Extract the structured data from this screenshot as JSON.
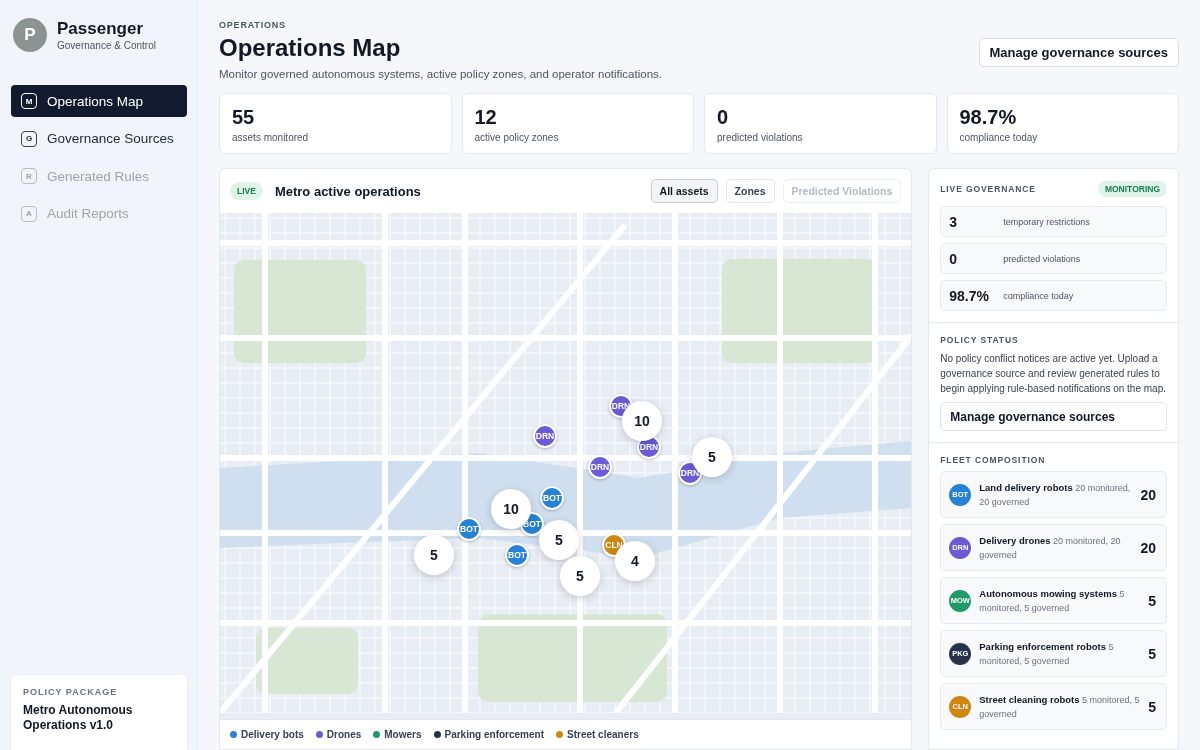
{
  "brand": {
    "initial": "P",
    "name": "Passenger",
    "tagline": "Governance & Control"
  },
  "nav": [
    {
      "key": "M",
      "label": "Operations Map",
      "selected": true,
      "disabled": false
    },
    {
      "key": "G",
      "label": "Governance Sources",
      "selected": false,
      "disabled": false
    },
    {
      "key": "R",
      "label": "Generated Rules",
      "selected": false,
      "disabled": true
    },
    {
      "key": "A",
      "label": "Audit Reports",
      "selected": false,
      "disabled": true
    }
  ],
  "policy_package": {
    "label": "POLICY PACKAGE",
    "name": "Metro Autonomous Operations v1.0"
  },
  "header": {
    "eyebrow": "OPERATIONS",
    "title": "Operations Map",
    "subtitle": "Monitor governed autonomous systems, active policy zones, and operator notifications.",
    "action": "Manage governance sources"
  },
  "stats": [
    {
      "value": "55",
      "label": "assets monitored"
    },
    {
      "value": "12",
      "label": "active policy zones"
    },
    {
      "value": "0",
      "label": "predicted violations"
    },
    {
      "value": "98.7%",
      "label": "compliance today"
    }
  ],
  "map": {
    "badge": "LIVE",
    "title": "Metro active operations",
    "filters": [
      {
        "label": "All assets",
        "selected": true,
        "disabled": false
      },
      {
        "label": "Zones",
        "selected": false,
        "disabled": false
      },
      {
        "label": "Predicted Violations",
        "selected": false,
        "disabled": true
      }
    ],
    "markers": [
      {
        "label": "DRN",
        "color": "#6b5bd6"
      },
      {
        "label": "DRN",
        "color": "#6b5bd6"
      },
      {
        "label": "DRN",
        "color": "#6b5bd6"
      },
      {
        "label": "DRN",
        "color": "#6b5bd6"
      },
      {
        "label": "DRN",
        "color": "#6b5bd6"
      },
      {
        "label": "BOT",
        "color": "#2582d6"
      },
      {
        "label": "BOT",
        "color": "#2582d6"
      },
      {
        "label": "BOT",
        "color": "#2582d6"
      },
      {
        "label": "BOT",
        "color": "#2582d6"
      },
      {
        "label": "CLN",
        "color": "#d0860f"
      }
    ],
    "clusters": [
      "10",
      "5",
      "10",
      "5",
      "5",
      "5",
      "4"
    ],
    "legend": [
      {
        "label": "Delivery bots",
        "color": "#2582d6"
      },
      {
        "label": "Drones",
        "color": "#6b5bd6"
      },
      {
        "label": "Mowers",
        "color": "#1f9a68"
      },
      {
        "label": "Parking enforcement",
        "color": "#27324a"
      },
      {
        "label": "Street cleaners",
        "color": "#d0860f"
      }
    ]
  },
  "live_governance": {
    "title": "LIVE GOVERNANCE",
    "status": "MONITORING",
    "metrics": [
      {
        "value": "3",
        "label": "temporary restrictions"
      },
      {
        "value": "0",
        "label": "predicted violations"
      },
      {
        "value": "98.7%",
        "label": "compliance today"
      }
    ]
  },
  "policy_status": {
    "title": "POLICY STATUS",
    "text": "No policy conflict notices are active yet. Upload a governance source and review generated rules to begin applying rule-based notifications on the map.",
    "action": "Manage governance sources"
  },
  "fleet": {
    "title": "FLEET COMPOSITION",
    "items": [
      {
        "code": "BOT",
        "color": "#2582d6",
        "name": "Land delivery robots",
        "detail": "20 monitored, 20 governed",
        "count": "20"
      },
      {
        "code": "DRN",
        "color": "#6b5bd6",
        "name": "Delivery drones",
        "detail": "20 monitored, 20 governed",
        "count": "20"
      },
      {
        "code": "MOW",
        "color": "#1f9a68",
        "name": "Autonomous mowing systems",
        "detail": "5 monitored, 5 governed",
        "count": "5"
      },
      {
        "code": "PKG",
        "color": "#27324a",
        "name": "Parking enforcement robots",
        "detail": "5 monitored, 5 governed",
        "count": "5"
      },
      {
        "code": "CLN",
        "color": "#d0860f",
        "name": "Street cleaning robots",
        "detail": "5 monitored, 5 governed",
        "count": "5"
      }
    ]
  }
}
